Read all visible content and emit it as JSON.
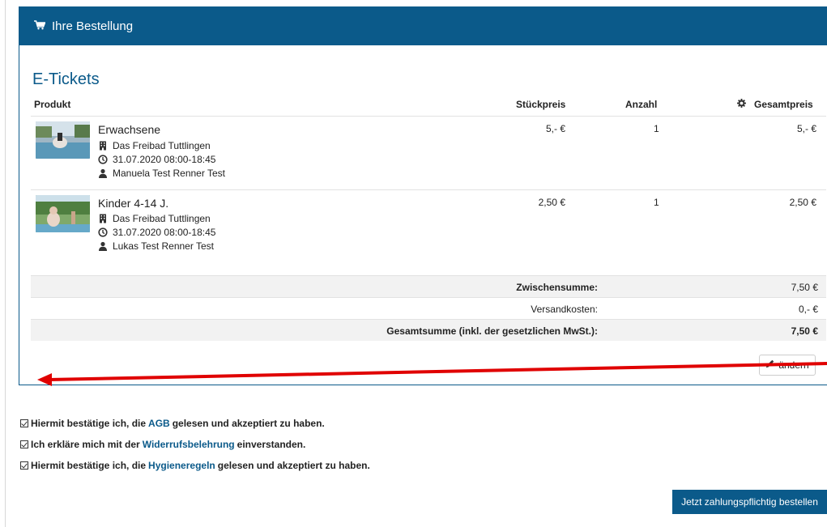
{
  "header": {
    "title": "Ihre Bestellung",
    "icon": "cart-icon"
  },
  "section_title": "E-Tickets",
  "table": {
    "columns": [
      "Produkt",
      "Stückpreis",
      "Anzahl",
      "Gesamtpreis"
    ],
    "rows": [
      {
        "name": "Erwachsene",
        "venue": "Das Freibad Tuttlingen",
        "datetime": "31.07.2020 08:00-18:45",
        "person": "Manuela Test Renner Test",
        "unit_price": "5,- €",
        "quantity": "1",
        "total": "5,- €"
      },
      {
        "name": "Kinder 4-14 J.",
        "venue": "Das Freibad Tuttlingen",
        "datetime": "31.07.2020 08:00-18:45",
        "person": "Lukas Test Renner Test",
        "unit_price": "2,50 €",
        "quantity": "1",
        "total": "2,50 €"
      }
    ]
  },
  "summary": {
    "subtotal_label": "Zwischensumme:",
    "subtotal_value": "7,50 €",
    "shipping_label": "Versandkosten:",
    "shipping_value": "0,- €",
    "total_label": "Gesamtsumme (inkl. der gesetzlichen MwSt.):",
    "total_value": "7,50 €"
  },
  "edit_button": "ändern",
  "consents": [
    {
      "before": "Hiermit bestätige ich, die",
      "link": "AGB",
      "after": "gelesen und akzeptiert zu haben.",
      "checked": true
    },
    {
      "before": "Ich erkläre mich mit der",
      "link": "Widerrufsbelehrung",
      "after": "einverstanden.",
      "checked": true
    },
    {
      "before": "Hiermit bestätige ich, die",
      "link": "Hygieneregeln",
      "after": "gelesen und akzeptiert zu haben.",
      "checked": true
    }
  ],
  "order_button": "Jetzt zahlungspflichtig bestellen",
  "colors": {
    "primary": "#0b5a8a",
    "annotation_arrow": "#e00000"
  }
}
